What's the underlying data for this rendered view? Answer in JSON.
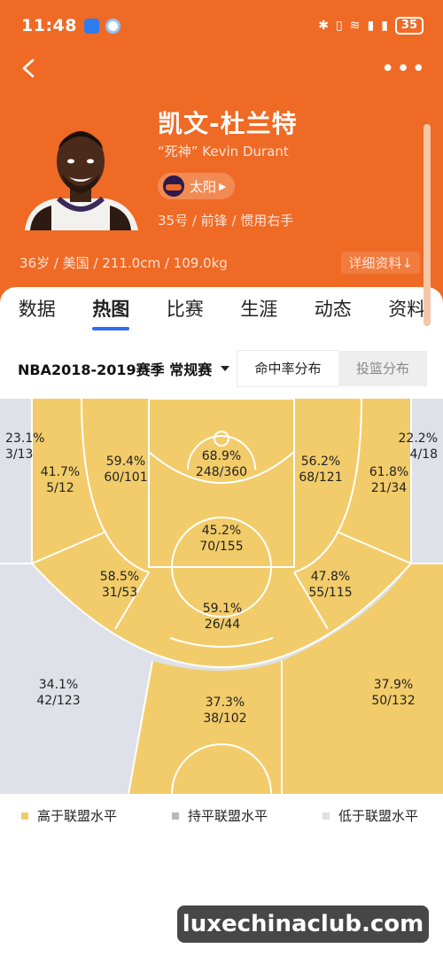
{
  "status_bar": {
    "time": "11:48",
    "battery": "35"
  },
  "player": {
    "name": "凯文-杜兰特",
    "nickname": "“死神” Kevin Durant",
    "team": "太阳",
    "bio": "35号 / 前锋 / 惯用右手",
    "stats": "36岁 / 美国 / 211.0cm / 109.0kg",
    "detail_label": "详细资料↓"
  },
  "tabs": [
    "数据",
    "热图",
    "比赛",
    "生涯",
    "动态",
    "资料"
  ],
  "active_tab": "热图",
  "filter": {
    "season": "NBA2018-2019赛季 常规赛",
    "mode_a": "命中率分布",
    "mode_b": "投篮分布"
  },
  "zones": [
    {
      "pct": "23.1%",
      "count": "3/13",
      "level": "low"
    },
    {
      "pct": "41.7%",
      "count": "5/12",
      "level": "high"
    },
    {
      "pct": "59.4%",
      "count": "60/101",
      "level": "high"
    },
    {
      "pct": "68.9%",
      "count": "248/360",
      "level": "high"
    },
    {
      "pct": "56.2%",
      "count": "68/121",
      "level": "high"
    },
    {
      "pct": "61.8%",
      "count": "21/34",
      "level": "high"
    },
    {
      "pct": "22.2%",
      "count": "4/18",
      "level": "low"
    },
    {
      "pct": "45.2%",
      "count": "70/155",
      "level": "high"
    },
    {
      "pct": "58.5%",
      "count": "31/53",
      "level": "high"
    },
    {
      "pct": "47.8%",
      "count": "55/115",
      "level": "high"
    },
    {
      "pct": "59.1%",
      "count": "26/44",
      "level": "high"
    },
    {
      "pct": "34.1%",
      "count": "42/123",
      "level": "low"
    },
    {
      "pct": "37.3%",
      "count": "38/102",
      "level": "high"
    },
    {
      "pct": "37.9%",
      "count": "50/132",
      "level": "high"
    }
  ],
  "legend": [
    {
      "label": "高于联盟水平",
      "color": "#f2cc6a"
    },
    {
      "label": "持平联盟水平",
      "color": "#b8b8b8"
    },
    {
      "label": "低于联盟水平",
      "color": "#dfe1e8"
    }
  ],
  "colors": {
    "header": "#ef6a25",
    "high": "#f2cc6a",
    "low": "#dfe1e8",
    "accent": "#2c6ef2"
  },
  "watermark": "luxechinaclub.com"
}
